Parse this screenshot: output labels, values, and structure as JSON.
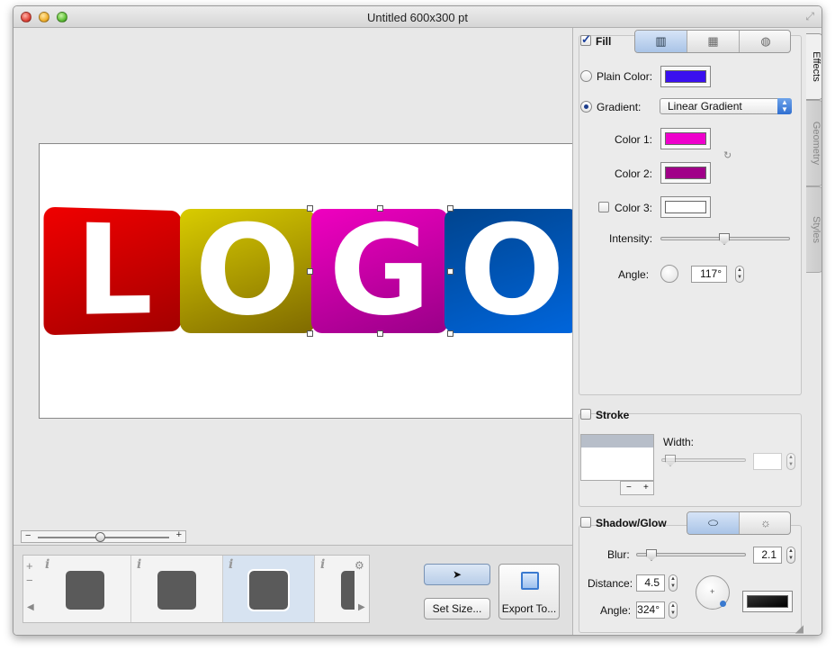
{
  "window": {
    "title": "Untitled 600x300 pt"
  },
  "logo": {
    "letters": [
      "L",
      "O",
      "G",
      "O"
    ],
    "colors": [
      "#e30000",
      "#b5a400",
      "#d800b0",
      "#0050b0"
    ]
  },
  "zoom": {
    "minus": "−",
    "plus": "+",
    "level": 0.46
  },
  "thumbnails": {
    "info_label": "i",
    "count_visible": 4,
    "selected_index": 2
  },
  "toolbar": {
    "set_size_label": "Set Size...",
    "export_label": "Export To..."
  },
  "inspector_tabs": [
    "Effects",
    "Geometry",
    "Styles"
  ],
  "fill": {
    "label": "Fill",
    "checked": true,
    "plain_color_label": "Plain Color:",
    "plain_color": "#3a10f0",
    "gradient_label": "Gradient:",
    "gradient_type": "Linear Gradient",
    "color1_label": "Color 1:",
    "color1": "#ee00cc",
    "color2_label": "Color 2:",
    "color2": "#a00088",
    "color3_label": "Color 3:",
    "color3": "#ffffff",
    "intensity_label": "Intensity:",
    "intensity": 0.5,
    "angle_label": "Angle:",
    "angle": "117°"
  },
  "stroke": {
    "label": "Stroke",
    "width_label": "Width:",
    "list_minus": "−",
    "list_plus": "+"
  },
  "shadow": {
    "label": "Shadow/Glow",
    "blur_label": "Blur:",
    "blur": "2.1",
    "distance_label": "Distance:",
    "distance": "4.5",
    "angle_label": "Angle:",
    "angle": "324°",
    "color": "#111111"
  }
}
